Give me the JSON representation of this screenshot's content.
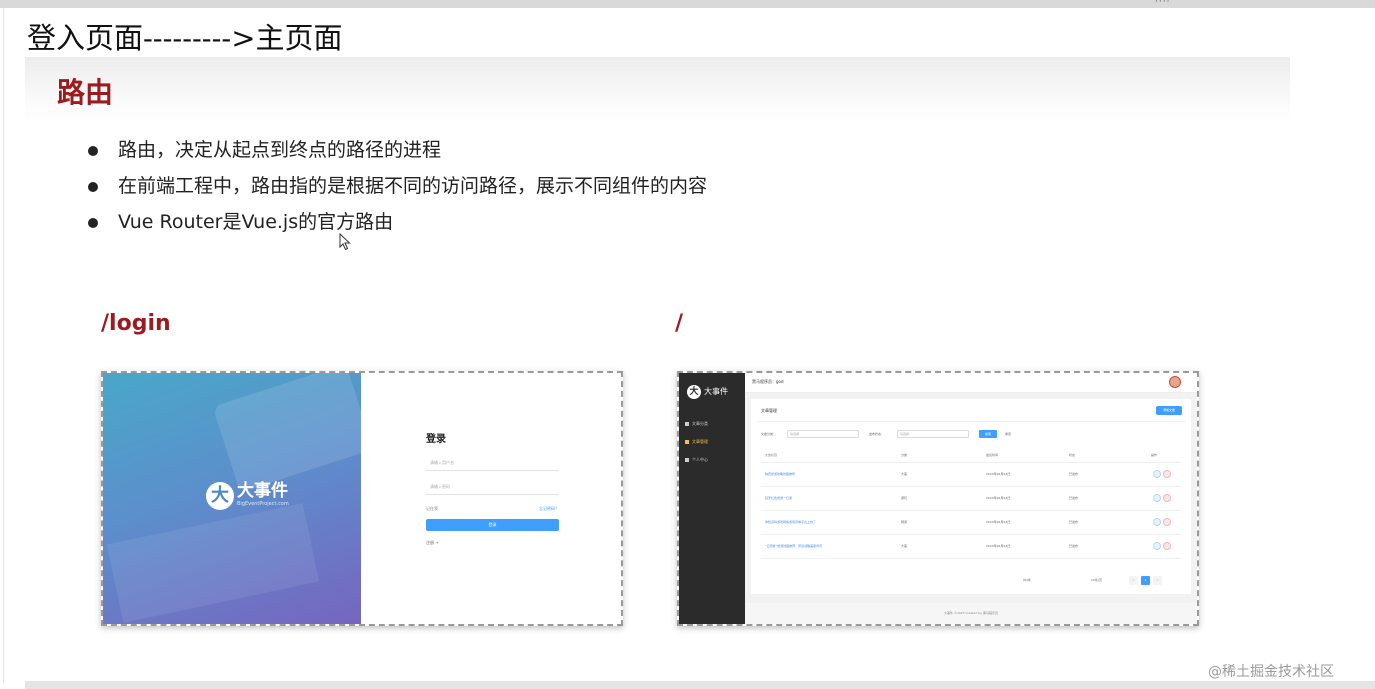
{
  "header": {
    "heading": "登入页面--------->主页面"
  },
  "slide": {
    "title": "路由",
    "bullets": [
      "路由，决定从起点到终点的路径的进程",
      "在前端工程中，路由指的是根据不同的访问路径，展示不同组件的内容",
      "Vue Router是Vue.js的官方路由"
    ],
    "login_route": "/login",
    "main_route": "/"
  },
  "login_screenshot": {
    "logo_text": "大事件",
    "logo_sub": "BigEventProject.com",
    "form_title": "登录",
    "username_placeholder": "请输入用户名",
    "password_placeholder": "请输入密码",
    "remember_label": "记住我",
    "forgot_link": "忘记密码？",
    "login_button": "登录",
    "register_link": "注册 →"
  },
  "main_screenshot": {
    "logo_text": "大事件",
    "greeting": "黑马程序员：god",
    "menu": [
      "文章分类",
      "文章管理",
      "个人中心"
    ],
    "card_title": "文章管理",
    "publish_button": "添加文章",
    "filter_category_label": "文章分类：",
    "filter_category_placeholder": "请选择",
    "filter_state_label": "发布状态：",
    "filter_state_placeholder": "请选择",
    "search_button": "搜索",
    "reset_button": "重置",
    "columns": [
      "文章标题",
      "分类",
      "发表时间",
      "状态",
      "操作"
    ],
    "rows": [
      {
        "title": "陕西旅游攻略线路推荐",
        "category": "大事",
        "date": "2023年09月03日",
        "state": "已发布"
      },
      {
        "title": "延安红色旅游一日游",
        "category": "游玩",
        "date": "2023年09月03日",
        "state": "已发布"
      },
      {
        "title": "你知道吗游戏网络游戏问卷平台上线了",
        "category": "网游",
        "date": "2023年09月03日",
        "state": "已发布"
      },
      {
        "title": "“云南游”旅游线路推荐，带您领略美丽风景",
        "category": "大事",
        "date": "2023年09月03日",
        "state": "已发布"
      }
    ],
    "pager_total": "共4条",
    "pager_size": "10条/页",
    "pager_current": "1",
    "footer": "大事件 ©2023 Created by 黑马程序员"
  },
  "watermark": "@稀土掘金技术社区",
  "top_dots": "····"
}
